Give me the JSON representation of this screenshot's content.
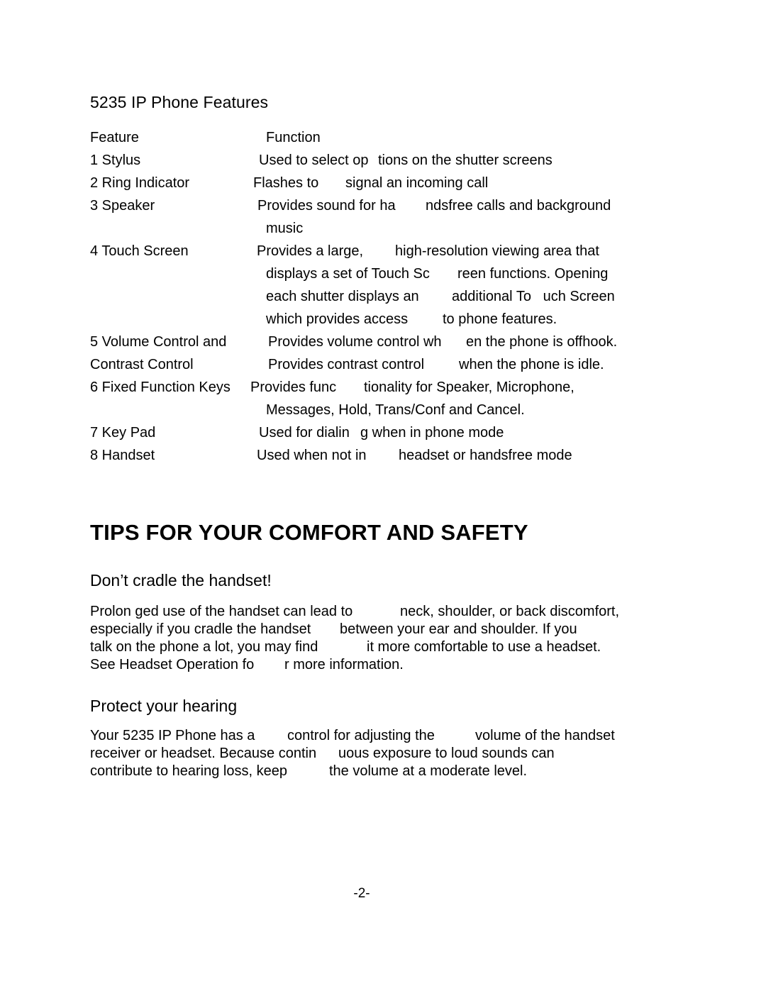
{
  "document": {
    "section_heading": "5235 IP Phone Features",
    "table": {
      "header": {
        "feature": "Feature",
        "function": "Function"
      },
      "rows": [
        {
          "feature": "1 Stylus",
          "lines": [
            {
              "indent": 365,
              "a": "Used to select op",
              "b_indent": 533,
              "b": "tions on the shutter screens"
            }
          ]
        },
        {
          "feature": "2 Ring Indicator",
          "lines": [
            {
              "indent": 357,
              "a": "Flashes to",
              "b_indent": 487,
              "b": "signal an incoming call"
            }
          ]
        },
        {
          "feature": "3 Speaker",
          "lines": [
            {
              "indent": 363,
              "a": "Provides sound for ha",
              "b_indent": 600,
              "b": "ndsfree calls and background"
            },
            {
              "indent": 375,
              "a": "music",
              "b_indent": 0,
              "b": ""
            }
          ]
        },
        {
          "feature": "4 Touch Screen",
          "lines": [
            {
              "indent": 362,
              "a": "Provides a large,",
              "b_indent": 557,
              "b": "high-resolution viewing area that"
            },
            {
              "indent": 375,
              "a": "displays a set of Touch Sc",
              "b_indent": 645,
              "b": "reen functions. Opening"
            },
            {
              "indent": 375,
              "a": "each shutter displays an",
              "b_indent": 637,
              "b": "additional To   uch Screen"
            },
            {
              "indent": 375,
              "a": "which provides access",
              "b_indent": 624,
              "b": "to phone features."
            }
          ]
        },
        {
          "feature": "5 Volume Control and",
          "lines": [
            {
              "indent": 378,
              "a": "Provides volume control wh",
              "b_indent": 657,
              "b": "en the phone is offhook."
            }
          ]
        },
        {
          "feature": "Contrast Control",
          "lines": [
            {
              "indent": 378,
              "a": "Provides contrast control",
              "b_indent": 647,
              "b": "when the phone is idle."
            }
          ]
        },
        {
          "feature": "6 Fixed Function Keys",
          "lines": [
            {
              "indent": 353,
              "a": "Provides func",
              "b_indent": 513,
              "b": "tionality for Speaker, Microphone,"
            },
            {
              "indent": 375,
              "a": "Messages, Hold, Trans/Conf and Cancel.",
              "b_indent": 0,
              "b": ""
            }
          ]
        },
        {
          "feature": "7 Key Pad",
          "lines": [
            {
              "indent": 365,
              "a": "Used for dialin",
              "b_indent": 508,
              "b": "g when in phone mode"
            }
          ]
        },
        {
          "feature": "8 Handset",
          "lines": [
            {
              "indent": 362,
              "a": "Used when not in",
              "b_indent": 562,
              "b": "headset or handsfree mode"
            }
          ]
        }
      ]
    },
    "big_heading": "TIPS FOR YOUR COMFORT AND SAFETY",
    "sections": [
      {
        "heading": "Don’t cradle the handset!",
        "lines": [
          {
            "a": "Prolon ged use of the handset can lead to",
            "b_indent": 437,
            "b": "neck, shoulder, or back discomfort,"
          },
          {
            "a": "especially if you cradle the handset",
            "b_indent": 352,
            "b": "between your ear and shoulder. If you"
          },
          {
            "a": "talk on the phone a lot, you may find",
            "b_indent": 390,
            "b": "it more comfortable to use a headset."
          },
          {
            "a": "See Headset Operation fo",
            "b_indent": 274,
            "b": "r more information."
          }
        ]
      },
      {
        "heading": "Protect your hearing",
        "lines": [
          {
            "a": "Your 5235 IP Phone has a",
            "b_indent": 278,
            "b": "control for adjusting the"
          },
          {
            "a": "",
            "b_indent": 0,
            "b": ""
          },
          {
            "a": "",
            "b_indent": 0,
            "b": ""
          }
        ]
      }
    ],
    "hearing_lines": [
      {
        "a": "Your 5235 IP Phone has a",
        "b_indent": 278,
        "b": "control for adjusting the",
        "c_indent": 543,
        "c": "volume of the handset"
      },
      {
        "a": "receiver or headset. Because contin",
        "b_indent": 350,
        "b": "uous exposure to loud sounds can",
        "c_indent": 0,
        "c": ""
      },
      {
        "a": "contribute to hearing loss, keep",
        "b_indent": 337,
        "b": "the volume at a moderate level.",
        "c_indent": 0,
        "c": ""
      }
    ],
    "footer": {
      "page_number": "-2-"
    }
  }
}
